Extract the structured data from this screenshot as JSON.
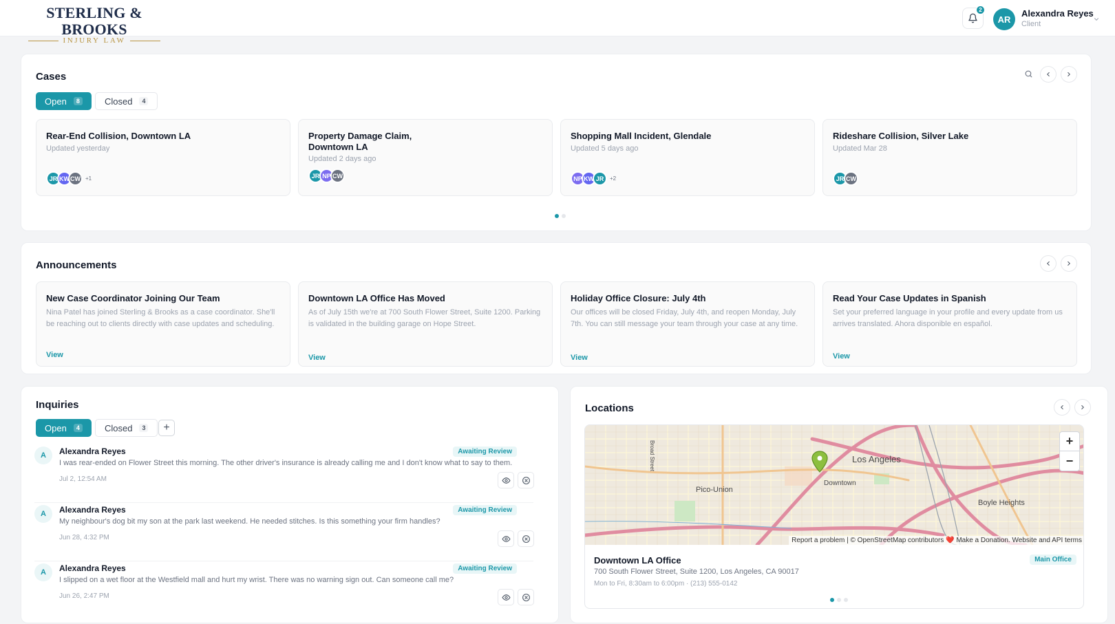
{
  "header": {
    "logo_main": "STERLING & BROOKS",
    "logo_sub": "INJURY LAW",
    "notification_count": "2",
    "user": {
      "initials": "AR",
      "name": "Alexandra Reyes",
      "role": "Client"
    }
  },
  "cases": {
    "title": "Cases",
    "tabs": [
      {
        "label": "Open",
        "count": "8"
      },
      {
        "label": "Closed",
        "count": "4"
      }
    ],
    "items": [
      {
        "title": "Rear-End Collision, Downtown LA",
        "updated": "Updated yesterday",
        "avatars": [
          "JR",
          "KW",
          "CW"
        ],
        "more": "+1"
      },
      {
        "title": "Property Damage Claim, Downtown LA",
        "updated": "Updated 2 days ago",
        "avatars": [
          "JR",
          "NP",
          "CW"
        ],
        "more": ""
      },
      {
        "title": "Shopping Mall Incident, Glendale",
        "updated": "Updated 5 days ago",
        "avatars": [
          "NP",
          "KW",
          "JR"
        ],
        "more": "+2"
      },
      {
        "title": "Rideshare Collision, Silver Lake",
        "updated": "Updated Mar 28",
        "avatars": [
          "JR",
          "CW"
        ],
        "more": ""
      }
    ]
  },
  "announcements": {
    "title": "Announcements",
    "items": [
      {
        "title": "New Case Coordinator Joining Our Team",
        "body": "Nina Patel has joined Sterling & Brooks as a case coordinator. She'll be reaching out to clients directly with case updates and scheduling.",
        "link": "View"
      },
      {
        "title": "Downtown LA Office Has Moved",
        "body": "As of July 15th we're at 700 South Flower Street, Suite 1200. Parking is validated in the building garage on Hope Street.",
        "link": "View"
      },
      {
        "title": "Holiday Office Closure: July 4th",
        "body": "Our offices will be closed Friday, July 4th, and reopen Monday, July 7th. You can still message your team through your case at any time.",
        "link": "View"
      },
      {
        "title": "Read Your Case Updates in Spanish",
        "body": "Set your preferred language in your profile and every update from us arrives translated. Ahora disponible en español.",
        "link": "View"
      }
    ]
  },
  "inquiries": {
    "title": "Inquiries",
    "tabs": [
      {
        "label": "Open",
        "count": "4"
      },
      {
        "label": "Closed",
        "count": "3"
      }
    ],
    "add_label": "+",
    "items": [
      {
        "initial": "A",
        "name": "Alexandra Reyes",
        "status": "Awaiting Review",
        "message": "I was rear-ended on Flower Street this morning. The other driver's insurance is already calling me and I don't know what to say to them.",
        "time": "Jul 2, 12:54 AM"
      },
      {
        "initial": "A",
        "name": "Alexandra Reyes",
        "status": "Awaiting Review",
        "message": "My neighbour's dog bit my son at the park last weekend. He needed stitches. Is this something your firm handles?",
        "time": "Jun 28, 4:32 PM"
      },
      {
        "initial": "A",
        "name": "Alexandra Reyes",
        "status": "Awaiting Review",
        "message": "I slipped on a wet floor at the Westfield mall and hurt my wrist. There was no warning sign out. Can someone call me?",
        "time": "Jun 26, 2:47 PM"
      }
    ]
  },
  "locations": {
    "title": "Locations",
    "map": {
      "zoom_in": "+",
      "zoom_out": "−",
      "attribution": "Report a problem | © OpenStreetMap contributors ❤️ Make a Donation. Website and API terms",
      "labels": {
        "los_angeles": "Los Angeles",
        "downtown": "Downtown",
        "pico_union": "Pico-Union",
        "boyle_heights": "Boyle Heights",
        "street_vertical": "Broad Street"
      }
    },
    "office": {
      "name": "Downtown LA Office",
      "badge": "Main Office",
      "address": "700 South Flower Street, Suite 1200, Los Angeles, CA 90017",
      "hours": "Mon to Fri, 8:30am to 6:00pm · (213) 555-0142"
    }
  },
  "colors": {
    "accent": "#1b97a8",
    "navy": "#1f2d4a",
    "gold": "#b89440",
    "avatar_JR": "#1b97a8",
    "avatar_KW": "#6366f1",
    "avatar_NP": "#7c6cf0",
    "avatar_CW": "#6b7280"
  }
}
